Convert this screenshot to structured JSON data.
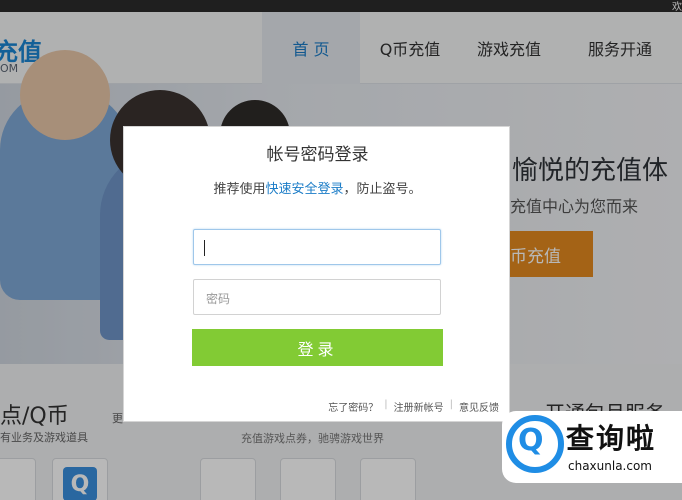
{
  "topbar": {
    "text": "欢"
  },
  "header": {
    "logo_cn": "充值",
    "logo_en": "OM",
    "nav": [
      {
        "label": "首 页",
        "active": true
      },
      {
        "label": "Q币充值",
        "active": false
      },
      {
        "label": "游戏充值",
        "active": false
      },
      {
        "label": "服务开通",
        "active": false
      }
    ]
  },
  "banner": {
    "slogan": "愉悦的充值体",
    "subslogan": "充值中心为您而来",
    "cta": "币充值"
  },
  "sections": {
    "left_title": "点/Q币",
    "left_sub": "有业务及游戏道具",
    "left_more": "更",
    "mid_sub": "充值游戏点券，驰骋游戏世界",
    "right_title": "开通包月服务",
    "tile_q": "Q"
  },
  "modal": {
    "title": "帐号密码登录",
    "hint_prefix": "推荐使用",
    "hint_link": "快速安全登录",
    "hint_suffix": "，防止盗号。",
    "account_value": "",
    "password_placeholder": "密码",
    "login_label": "登录",
    "links": {
      "forgot": "忘了密码？",
      "register": "注册新帐号",
      "feedback": "意见反馈"
    }
  },
  "watermark": {
    "cn": "查询啦",
    "en": "chaxunla.com",
    "icon_char": "Q"
  },
  "colors": {
    "accent_blue": "#1b7cc7",
    "login_green": "#82cb34",
    "cta_orange": "#e38a1f"
  }
}
